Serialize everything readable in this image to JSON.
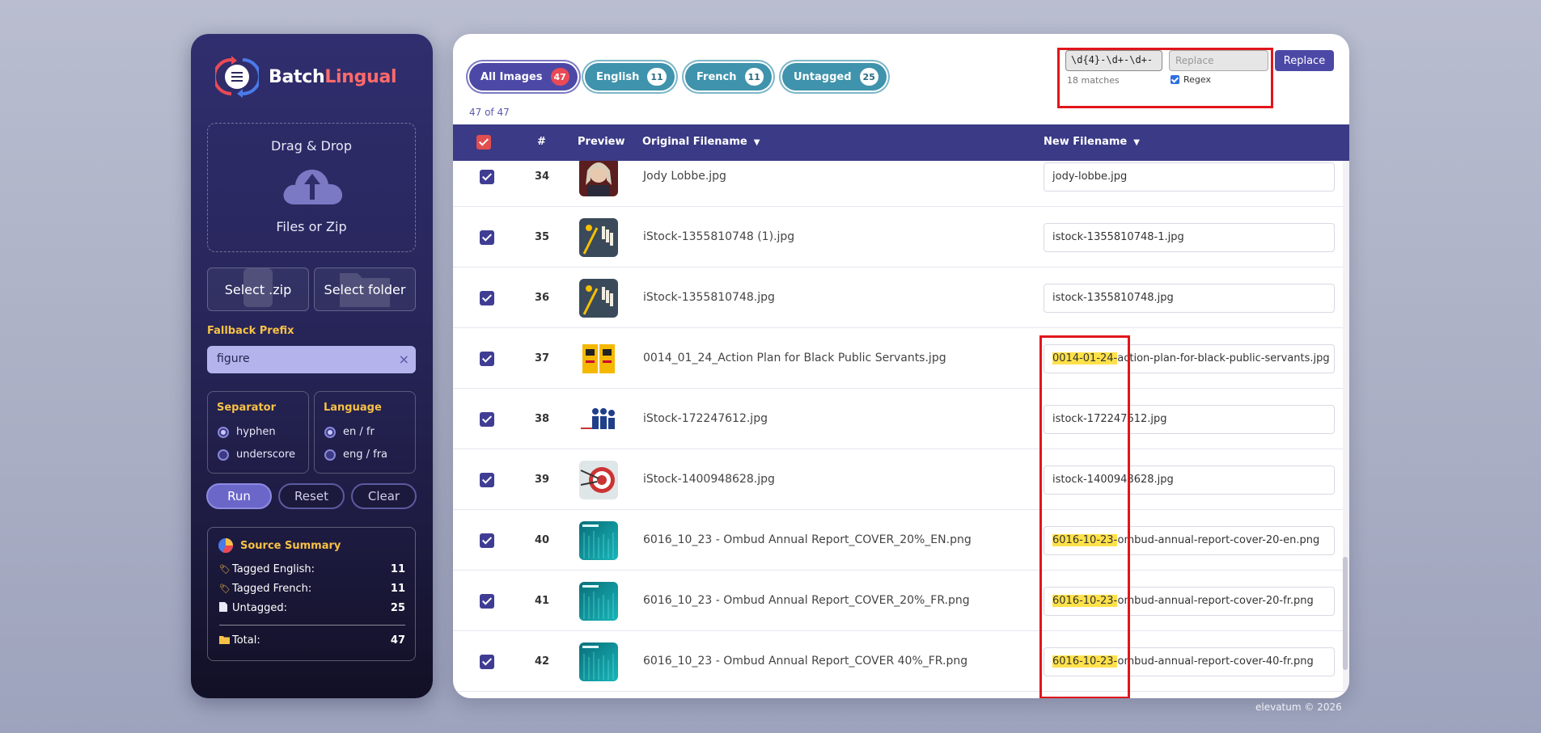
{
  "app": {
    "name_part1": "Batch",
    "name_part2": "Lingual",
    "accent": "#ff6a6a"
  },
  "dropzone": {
    "title": "Drag & Drop",
    "subtitle": "Files or Zip",
    "icon": "cloud-upload-icon"
  },
  "buttons": {
    "select_zip": "Select .zip",
    "select_folder": "Select folder",
    "run": "Run",
    "reset": "Reset",
    "clear": "Clear"
  },
  "fallback": {
    "label": "Fallback Prefix",
    "value": "figure",
    "clear_icon": "×"
  },
  "separator": {
    "title": "Separator",
    "options": [
      "hyphen",
      "underscore"
    ],
    "selected": "hyphen"
  },
  "language": {
    "title": "Language",
    "options": [
      "en / fr",
      "eng / fra"
    ],
    "selected": "en / fr"
  },
  "summary": {
    "title": "Source Summary",
    "rows": [
      {
        "label": "Tagged English:",
        "value": "11",
        "icon": "tag-icon"
      },
      {
        "label": "Tagged French:",
        "value": "11",
        "icon": "tag-icon"
      },
      {
        "label": "Untagged:",
        "value": "25",
        "icon": "document-icon"
      }
    ],
    "total_label": "Total:",
    "total_value": "47"
  },
  "filters": [
    {
      "label": "All Images",
      "count": "47",
      "active": true
    },
    {
      "label": "English",
      "count": "11"
    },
    {
      "label": "French",
      "count": "11"
    },
    {
      "label": "Untagged",
      "count": "25"
    }
  ],
  "count_note": "47 of 47",
  "regex": {
    "pattern": "\\d{4}-\\d+-\\d+-",
    "replace_placeholder": "Replace",
    "matches": "18 matches",
    "regex_label": "Regex",
    "regex_checked": true,
    "button": "Replace"
  },
  "table": {
    "headers": {
      "num": "#",
      "preview": "Preview",
      "original": "Original Filename",
      "new": "New Filename"
    },
    "rows": [
      {
        "num": "34",
        "orig": "Jody Lobbe.jpg",
        "hl": "",
        "rest": "jody-lobbe.jpg",
        "thumb": "portrait"
      },
      {
        "num": "35",
        "orig": "iStock-1355810748 (1).jpg",
        "hl": "",
        "rest": "istock-1355810748-1.jpg",
        "thumb": "bowling"
      },
      {
        "num": "36",
        "orig": "iStock-1355810748.jpg",
        "hl": "",
        "rest": "istock-1355810748.jpg",
        "thumb": "bowling"
      },
      {
        "num": "37",
        "orig": "0014_01_24_Action Plan for Black Public Servants.jpg",
        "hl": "0014-01-24-",
        "rest": "action-plan-for-black-public-servants.jpg",
        "thumb": "poster"
      },
      {
        "num": "38",
        "orig": "iStock-172247612.jpg",
        "hl": "",
        "rest": "istock-172247612.jpg",
        "thumb": "people"
      },
      {
        "num": "39",
        "orig": "iStock-1400948628.jpg",
        "hl": "",
        "rest": "istock-1400948628.jpg",
        "thumb": "target"
      },
      {
        "num": "40",
        "orig": "6016_10_23 - Ombud Annual Report_COVER_20%_EN.png",
        "hl": "6016-10-23-",
        "rest": "ombud-annual-report-cover-20-en.png",
        "thumb": "teal"
      },
      {
        "num": "41",
        "orig": "6016_10_23 - Ombud Annual Report_COVER_20%_FR.png",
        "hl": "6016-10-23-",
        "rest": "ombud-annual-report-cover-20-fr.png",
        "thumb": "teal"
      },
      {
        "num": "42",
        "orig": "6016_10_23 - Ombud Annual Report_COVER 40%_FR.png",
        "hl": "6016-10-23-",
        "rest": "ombud-annual-report-cover-40-fr.png",
        "thumb": "teal"
      }
    ]
  },
  "footer": "elevatum © 2026",
  "colors": {
    "sidebar_top": "#302e6e",
    "primary": "#4c48a6",
    "teal": "#3f93ac",
    "highlight": "#ffe14a",
    "annotation": "#e0161c",
    "label_gold": "#f8c146"
  }
}
